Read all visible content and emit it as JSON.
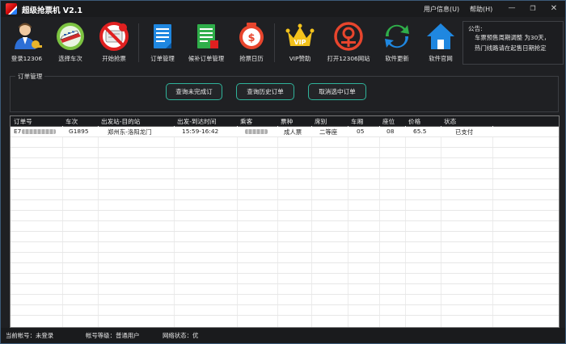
{
  "window": {
    "title": "超级抢票机 V2.1",
    "menu": {
      "user_info": "用户信息(U)",
      "help": "帮助(H)"
    }
  },
  "toolbar": {
    "items": [
      {
        "label": "登录12306",
        "icon": "login-user-icon"
      },
      {
        "label": "选择车次",
        "icon": "train-select-icon"
      },
      {
        "label": "开始抢票",
        "icon": "ticket-grab-icon"
      },
      {
        "label": "订单管理",
        "icon": "order-document-icon"
      },
      {
        "label": "候补订单管理",
        "icon": "waitlist-document-icon"
      },
      {
        "label": "抢票日历",
        "icon": "calendar-clock-icon"
      },
      {
        "label": "VIP赞助",
        "icon": "vip-crown-icon"
      },
      {
        "label": "打开12306网站",
        "icon": "railway-logo-icon"
      },
      {
        "label": "软件更新",
        "icon": "update-arrows-icon"
      },
      {
        "label": "软件官网",
        "icon": "home-icon"
      }
    ]
  },
  "notice": {
    "title": "公告:",
    "line1": "车票预售周期调整 为30天，",
    "line2": "热门线路请在起售日期抢定"
  },
  "order_group": {
    "title": "订单管理",
    "buttons": {
      "unfinished": "查询未完成订",
      "history": "查询历史订单",
      "cancel": "取消选中订单"
    }
  },
  "table": {
    "columns": [
      "订单号",
      "车次",
      "出发站-目的站",
      "出发-到达时间",
      "乘客",
      "票种",
      "席别",
      "车厢",
      "座位",
      "价格",
      "状态"
    ],
    "rows": [
      {
        "order_no": "E7",
        "train": "G1895",
        "route": "郑州东-洛阳龙门",
        "time": "15:59-16:42",
        "ticket_type": "成人票",
        "seat_class": "二等座",
        "car": "05",
        "seat": "08",
        "price": "65.5",
        "status": "已支付"
      }
    ]
  },
  "status_bar": {
    "account": "当前帐号：未登录",
    "level": "帐号等级：普通用户",
    "network": "网络状态：优"
  },
  "colors": {
    "accent_button_border": "#2fb39a",
    "window_bg": "#1f2023",
    "table_bg": "#ffffff"
  }
}
